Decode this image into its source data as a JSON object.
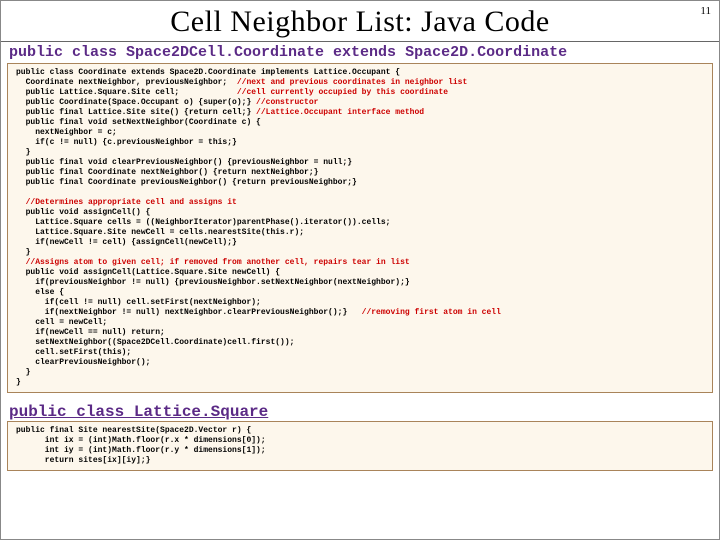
{
  "pagenum": "11",
  "title": "Cell Neighbor List: Java Code",
  "subtitle1": "public class Space2DCell.Coordinate extends Space2D.Coordinate",
  "code1": "public class Coordinate extends Space2D.Coordinate implements Lattice.Occupant {\n  Coordinate nextNeighbor, previousNeighbor;  ",
  "code1c1": "//next and previous coordinates in neighbor list",
  "code1b": "\n  public Lattice.Square.Site cell;            ",
  "code1c2": "//cell currently occupied by this coordinate",
  "code1c": "\n  public Coordinate(Space.Occupant o) {super(o);} ",
  "code1c3": "//constructor",
  "code1d": "\n  public final Lattice.Site site() {return cell;} ",
  "code1c4": "//Lattice.Occupant interface method",
  "code1e": "\n  public final void setNextNeighbor(Coordinate c) {\n    nextNeighbor = c;\n    if(c != null) {c.previousNeighbor = this;}\n  }\n  public final void clearPreviousNeighbor() {previousNeighbor = null;}\n  public final Coordinate nextNeighbor() {return nextNeighbor;}\n  public final Coordinate previousNeighbor() {return previousNeighbor;}\n\n",
  "code1c5": "  //Determines appropriate cell and assigns it",
  "code1f": "\n  public void assignCell() {\n    Lattice.Square cells = ((NeighborIterator)parentPhase().iterator()).cells;\n    Lattice.Square.Site newCell = cells.nearestSite(this.r);\n    if(newCell != cell) {assignCell(newCell);}\n  }\n",
  "code1c6": "  //Assigns atom to given cell; if removed from another cell, repairs tear in list",
  "code1g": "\n  public void assignCell(Lattice.Square.Site newCell) {\n    if(previousNeighbor != null) {previousNeighbor.setNextNeighbor(nextNeighbor);}\n    else {\n      if(cell != null) cell.setFirst(nextNeighbor);\n      if(nextNeighbor != null) nextNeighbor.clearPreviousNeighbor();}   ",
  "code1c7": "//removing first atom in cell",
  "code1h": "\n    cell = newCell;\n    if(newCell == null) return;\n    setNextNeighbor((Space2DCell.Coordinate)cell.first());\n    cell.setFirst(this);\n    clearPreviousNeighbor();\n  }\n}",
  "subtitle2": "public class Lattice.Square",
  "code2": "public final Site nearestSite(Space2D.Vector r) {\n      int ix = (int)Math.floor(r.x * dimensions[0]);\n      int iy = (int)Math.floor(r.y * dimensions[1]);\n      return sites[ix][iy];}"
}
